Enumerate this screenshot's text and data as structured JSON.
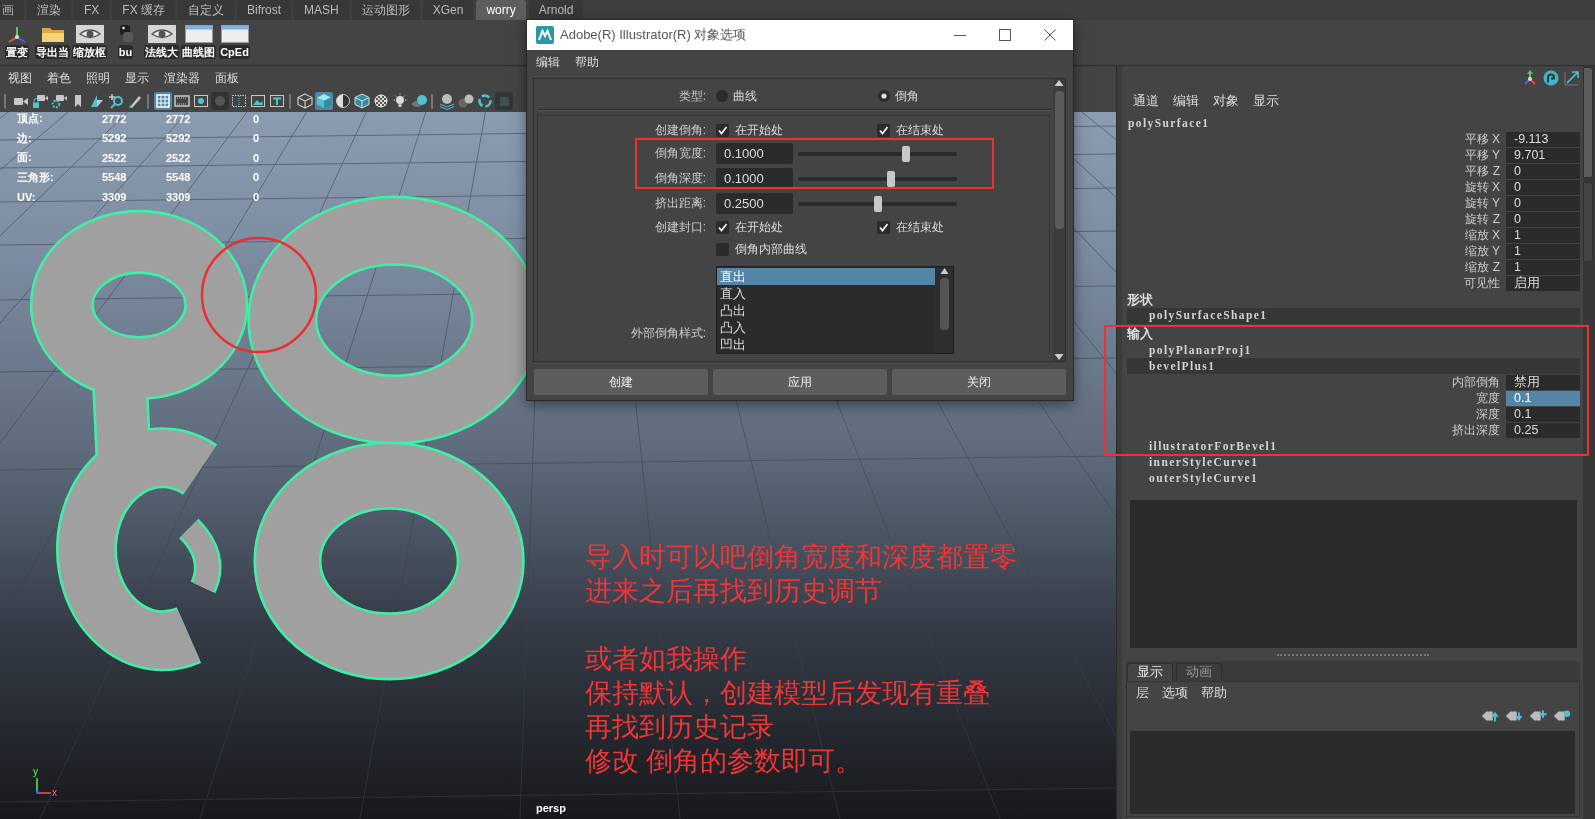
{
  "shelf": {
    "tabs": [
      {
        "label": "画",
        "selected": false
      },
      {
        "label": "渲染",
        "selected": false
      },
      {
        "label": "FX",
        "selected": false
      },
      {
        "label": "FX 缓存",
        "selected": false
      },
      {
        "label": "自定义",
        "selected": false
      },
      {
        "label": "Bifrost",
        "selected": false
      },
      {
        "label": "MASH",
        "selected": false
      },
      {
        "label": "运动图形",
        "selected": false
      },
      {
        "label": "XGen",
        "selected": false
      },
      {
        "label": "worry",
        "selected": true
      },
      {
        "label": "Arnold",
        "selected": false
      }
    ],
    "tools": [
      {
        "label": "置变"
      },
      {
        "label": "导出当"
      },
      {
        "label": "缩放枢"
      },
      {
        "label": "bu"
      },
      {
        "label": "法线大"
      },
      {
        "label": "曲线图"
      },
      {
        "label": "CpEd"
      }
    ]
  },
  "viewport": {
    "menu": [
      "视图",
      "着色",
      "照明",
      "显示",
      "渲染器",
      "面板"
    ],
    "toolbar": [
      {
        "selected": false
      },
      {
        "selected": false
      },
      {
        "selected": false
      },
      {
        "selected": false
      },
      {
        "selected": false
      },
      {
        "selected": false
      },
      {
        "selected": false
      },
      {
        "selected": true
      },
      {
        "selected": false
      },
      {
        "selected": false
      },
      {
        "selected": false
      },
      {
        "selected": false
      },
      {
        "selected": false
      },
      {
        "selected": false
      },
      {
        "selected": false
      },
      {
        "selected": true
      },
      {
        "selected": false
      },
      {
        "selected": false
      },
      {
        "selected": false
      },
      {
        "selected": false
      },
      {
        "selected": false
      },
      {
        "selected": false
      },
      {
        "selected": false
      },
      {
        "selected": false
      },
      {
        "selected": false
      }
    ],
    "hud": [
      {
        "label": "顶点:",
        "values": [
          "2772",
          "2772",
          "0"
        ]
      },
      {
        "label": "边:",
        "values": [
          "5292",
          "5292",
          "0"
        ]
      },
      {
        "label": "面:",
        "values": [
          "2522",
          "2522",
          "0"
        ]
      },
      {
        "label": "三角形:",
        "values": [
          "5548",
          "5548",
          "0"
        ]
      },
      {
        "label": "UV:",
        "values": [
          "3309",
          "3309",
          "0"
        ]
      }
    ],
    "note": {
      "paragraphs": [
        [
          "导入时可以吧倒角宽度和深度都置零",
          "进来之后再找到历史调节"
        ],
        [
          "或者如我操作",
          "保持默认，创建模型后发现有重叠",
          "再找到历史记录",
          "修改 倒角的参数即可。"
        ]
      ]
    },
    "camera": "persp",
    "axis": {
      "x": "x",
      "y": "y"
    }
  },
  "dialog": {
    "title": "Adobe(R) Illustrator(R) 对象选项",
    "menu": [
      "编辑",
      "帮助"
    ],
    "type": {
      "label": "类型:",
      "options": [
        {
          "label": "曲线",
          "selected": false
        },
        {
          "label": "倒角",
          "selected": true
        }
      ]
    },
    "rows": [
      {
        "kind": "checks",
        "label": "创建倒角:",
        "highlighted": false,
        "checks": [
          {
            "label": "在开始处",
            "checked": true
          },
          {
            "label": "在结束处",
            "checked": true
          }
        ]
      },
      {
        "kind": "slider",
        "label": "倒角宽度:",
        "highlighted": true,
        "value": "0.1000",
        "level": 0.69
      },
      {
        "kind": "slider",
        "label": "倒角深度:",
        "highlighted": true,
        "value": "0.1000",
        "level": 0.59
      },
      {
        "kind": "slider",
        "label": "挤出距离:",
        "highlighted": false,
        "value": "0.2500",
        "level": 0.5
      },
      {
        "kind": "checks",
        "label": "创建封口:",
        "highlighted": false,
        "checks": [
          {
            "label": "在开始处",
            "checked": true
          },
          {
            "label": "在结束处",
            "checked": true
          }
        ]
      },
      {
        "kind": "checks",
        "highlighted": false,
        "checks": [
          {
            "label": "倒角内部曲线",
            "checked": false
          }
        ]
      },
      {
        "kind": "list",
        "label": "外部倒角样式:",
        "highlighted": false,
        "items": [
          {
            "label": "直出",
            "selected": true
          },
          {
            "label": "直入",
            "selected": false
          },
          {
            "label": "凸出",
            "selected": false
          },
          {
            "label": "凸入",
            "selected": false
          },
          {
            "label": "凹出",
            "selected": false
          }
        ]
      }
    ],
    "buttons": [
      "创建",
      "应用",
      "关闭"
    ]
  },
  "channel_box": {
    "menu": [
      "通道",
      "编辑",
      "对象",
      "显示"
    ],
    "object": "polySurface1",
    "attributes": [
      {
        "label": "平移 X",
        "value": "-9.113"
      },
      {
        "label": "平移 Y",
        "value": "9.701"
      },
      {
        "label": "平移 Z",
        "value": "0"
      },
      {
        "label": "旋转 X",
        "value": "0"
      },
      {
        "label": "旋转 Y",
        "value": "0"
      },
      {
        "label": "旋转 Z",
        "value": "0"
      },
      {
        "label": "缩放 X",
        "value": "1"
      },
      {
        "label": "缩放 Y",
        "value": "1"
      },
      {
        "label": "缩放 Z",
        "value": "1"
      },
      {
        "label": "可见性",
        "value": "启用"
      }
    ],
    "shape_header": "形状",
    "shapes": [
      {
        "name": "polySurfaceShape1",
        "selected": true
      }
    ],
    "inputs_header": "输入",
    "inputs": [
      {
        "name": "polyPlanarProj1",
        "selected": false,
        "highlighted": true
      },
      {
        "name": "bevelPlus1",
        "selected": true,
        "highlighted": true,
        "attributes": [
          {
            "label": "内部倒角",
            "value": "禁用",
            "selected": false
          },
          {
            "label": "宽度",
            "value": "0.1",
            "selected": true
          },
          {
            "label": "深度",
            "value": "0.1",
            "selected": false
          },
          {
            "label": "挤出深度",
            "value": "0.25",
            "selected": false
          }
        ]
      },
      {
        "name": "illustratorForBevel1",
        "selected": false,
        "highlighted": true
      },
      {
        "name": "innerStyleCurve1",
        "selected": false,
        "highlighted": false
      },
      {
        "name": "outerStyleCurve1",
        "selected": false,
        "highlighted": false
      }
    ],
    "side_tabs": [
      {
        "selected": true
      },
      {
        "selected": false
      }
    ]
  },
  "layer_editor": {
    "tabs": [
      {
        "label": "显示",
        "selected": true
      },
      {
        "label": "动画",
        "selected": false
      }
    ],
    "menu": [
      "层",
      "选项",
      "帮助"
    ]
  }
}
